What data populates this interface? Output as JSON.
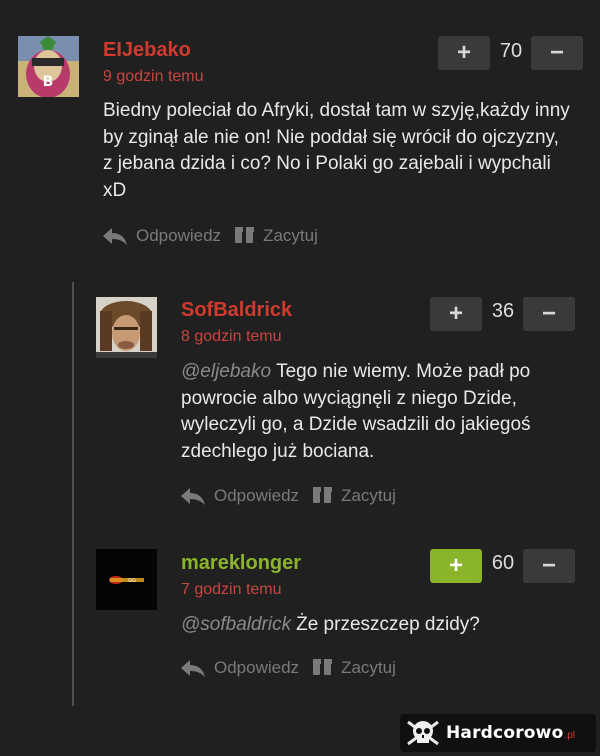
{
  "colors": {
    "background": "#202020",
    "username_red": "#d13b2f",
    "username_green": "#8ab42a",
    "timestamp": "#c9453f",
    "upvote_active": "#8ab42a"
  },
  "actions": {
    "reply_label": "Odpowiedz",
    "quote_label": "Zacytuj"
  },
  "vote": {
    "up_label": "+",
    "down_label": "−"
  },
  "comments": [
    {
      "author": "EIJebako",
      "time": "9 godzin temu",
      "score": "70",
      "mention": "",
      "text": "Biedny poleciał do Afryki, dostał tam w szyję,każdy inny by zginął ale nie on! Nie poddał się wrócił do ojczyzny, z jebana dzida i co? No i Polaki go zajebali i wypchali xD"
    },
    {
      "author": "SofBaldrick",
      "time": "8 godzin temu",
      "score": "36",
      "mention": "@eljebako",
      "text": "Tego nie wiemy. Może padł po powrocie albo wyciągnęli z niego Dzide, wyleczyli go, a Dzide wsadzili do jakiegoś zdechlego już bociana."
    },
    {
      "author": "mareklonger",
      "time": "7 godzin temu",
      "score": "60",
      "mention": "@sofbaldrick",
      "text": "Że przeszczep dzidy?"
    }
  ],
  "watermark": {
    "brand": "Hardcorowo",
    "tld": ".pl"
  }
}
